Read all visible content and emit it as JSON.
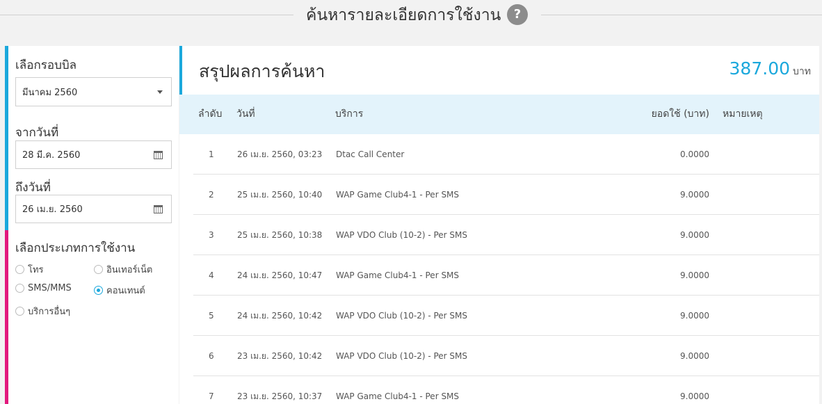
{
  "header": {
    "title": "ค้นหารายละเอียดการใช้งาน",
    "help_icon": "?"
  },
  "sidebar": {
    "bill_cycle_label": "เลือกรอบบิล",
    "bill_cycle_value": "มีนาคม 2560",
    "from_label": "จากวันที่",
    "from_value": "28 มี.ค. 2560",
    "to_label": "ถึงวันที่",
    "to_value": "26 เม.ย. 2560",
    "type_label": "เลือกประเภทการใช้งาน",
    "types": [
      {
        "label": "โทร",
        "selected": false
      },
      {
        "label": "อินเทอร์เน็ต",
        "selected": false
      },
      {
        "label": "SMS/MMS",
        "selected": false
      },
      {
        "label": "คอนเทนต์",
        "selected": true
      },
      {
        "label": "บริการอื่นๆ",
        "selected": false
      }
    ]
  },
  "summary": {
    "title": "สรุปผลการค้นหา",
    "total": "387.00",
    "unit": "บาท"
  },
  "table": {
    "columns": {
      "no": "ลำดับ",
      "date": "วันที่",
      "service": "บริการ",
      "amount": "ยอดใช้ (บาท)",
      "note": "หมายเหตุ"
    },
    "rows": [
      {
        "no": "1",
        "date": "26 เม.ย. 2560, 03:23",
        "service": "Dtac Call Center",
        "amount": "0.0000",
        "note": ""
      },
      {
        "no": "2",
        "date": "25 เม.ย. 2560, 10:40",
        "service": "WAP Game Club4-1 - Per SMS",
        "amount": "9.0000",
        "note": ""
      },
      {
        "no": "3",
        "date": "25 เม.ย. 2560, 10:38",
        "service": "WAP VDO Club (10-2) - Per SMS",
        "amount": "9.0000",
        "note": ""
      },
      {
        "no": "4",
        "date": "24 เม.ย. 2560, 10:47",
        "service": "WAP Game Club4-1 - Per SMS",
        "amount": "9.0000",
        "note": ""
      },
      {
        "no": "5",
        "date": "24 เม.ย. 2560, 10:42",
        "service": "WAP VDO Club (10-2) - Per SMS",
        "amount": "9.0000",
        "note": ""
      },
      {
        "no": "6",
        "date": "23 เม.ย. 2560, 10:42",
        "service": "WAP VDO Club (10-2) - Per SMS",
        "amount": "9.0000",
        "note": ""
      },
      {
        "no": "7",
        "date": "23 เม.ย. 2560, 10:37",
        "service": "WAP Game Club4-1 - Per SMS",
        "amount": "9.0000",
        "note": ""
      }
    ]
  },
  "colors": {
    "accent_blue": "#1ba8dc",
    "accent_pink": "#e2197d",
    "table_header_bg": "#e3f3fb"
  }
}
